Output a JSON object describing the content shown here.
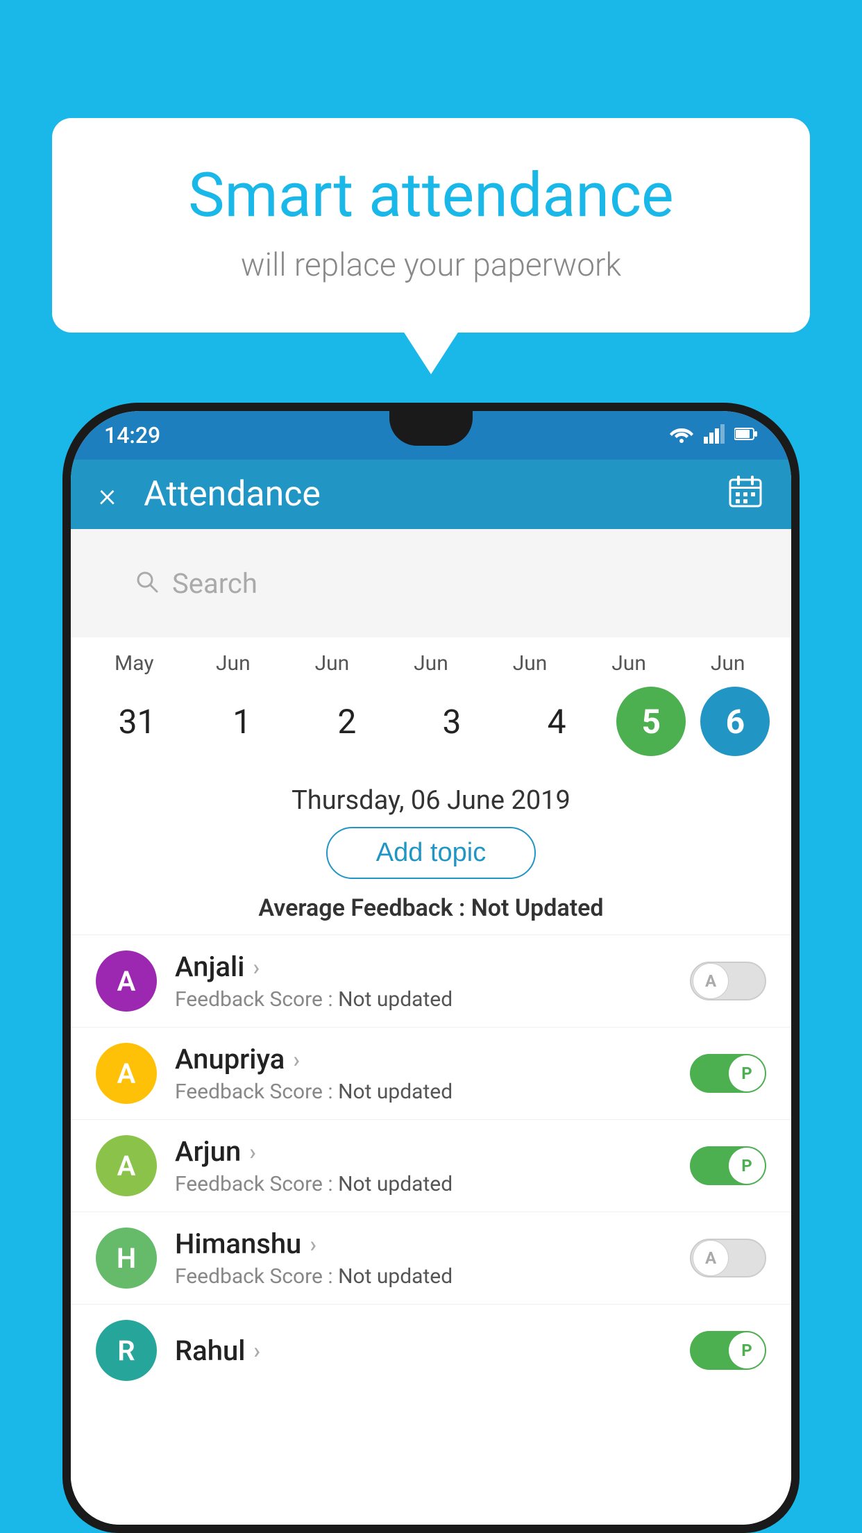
{
  "background": {
    "color": "#1ab8e8"
  },
  "bubble": {
    "title": "Smart attendance",
    "subtitle": "will replace your paperwork"
  },
  "status_bar": {
    "time": "14:29",
    "wifi": "▲",
    "signal": "▲",
    "battery": "▐"
  },
  "app_bar": {
    "title": "Attendance",
    "close_label": "×",
    "calendar_icon": "📅"
  },
  "search": {
    "placeholder": "Search"
  },
  "calendar": {
    "months": [
      "May",
      "Jun",
      "Jun",
      "Jun",
      "Jun",
      "Jun",
      "Jun"
    ],
    "dates": [
      "31",
      "1",
      "2",
      "3",
      "4",
      "5",
      "6"
    ],
    "today_index": 5,
    "selected_index": 6
  },
  "selected_date_label": "Thursday, 06 June 2019",
  "add_topic_label": "Add topic",
  "avg_feedback_label": "Average Feedback :",
  "avg_feedback_value": "Not Updated",
  "students": [
    {
      "name": "Anjali",
      "avatar_letter": "A",
      "avatar_color": "purple",
      "feedback_label": "Feedback Score :",
      "feedback_value": "Not updated",
      "toggle_state": "off",
      "toggle_letter": "A"
    },
    {
      "name": "Anupriya",
      "avatar_letter": "A",
      "avatar_color": "yellow",
      "feedback_label": "Feedback Score :",
      "feedback_value": "Not updated",
      "toggle_state": "on",
      "toggle_letter": "P"
    },
    {
      "name": "Arjun",
      "avatar_letter": "A",
      "avatar_color": "green-light",
      "feedback_label": "Feedback Score :",
      "feedback_value": "Not updated",
      "toggle_state": "on",
      "toggle_letter": "P"
    },
    {
      "name": "Himanshu",
      "avatar_letter": "H",
      "avatar_color": "green-mid",
      "feedback_label": "Feedback Score :",
      "feedback_value": "Not updated",
      "toggle_state": "off",
      "toggle_letter": "A"
    }
  ]
}
